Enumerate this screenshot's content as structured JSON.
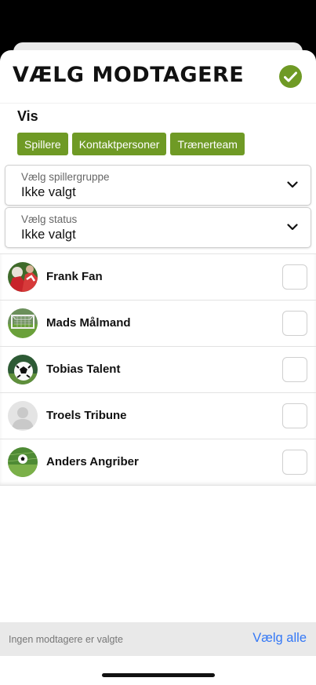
{
  "header": {
    "title": "VÆLG MODTAGERE",
    "confirm_icon": "check-circle-icon",
    "accent_color": "#6f9a25"
  },
  "filter": {
    "vis_label": "Vis",
    "chips": [
      {
        "label": "Spillere"
      },
      {
        "label": "Kontaktpersoner"
      },
      {
        "label": "Trænerteam"
      }
    ]
  },
  "selects": [
    {
      "label": "Vælg spillergruppe",
      "value": "Ikke valgt"
    },
    {
      "label": "Vælg status",
      "value": "Ikke valgt"
    }
  ],
  "recipients": [
    {
      "name": "Frank Fan",
      "avatar": "fan-photo"
    },
    {
      "name": "Mads Målmand",
      "avatar": "goal-photo"
    },
    {
      "name": "Tobias Talent",
      "avatar": "football-photo"
    },
    {
      "name": "Troels Tribune",
      "avatar": "default-person-avatar"
    },
    {
      "name": "Anders Angriber",
      "avatar": "football-grass-photo"
    }
  ],
  "footer": {
    "status": "Ingen modtagere er valgte",
    "select_all": "Vælg alle",
    "link_color": "#3478f6"
  }
}
